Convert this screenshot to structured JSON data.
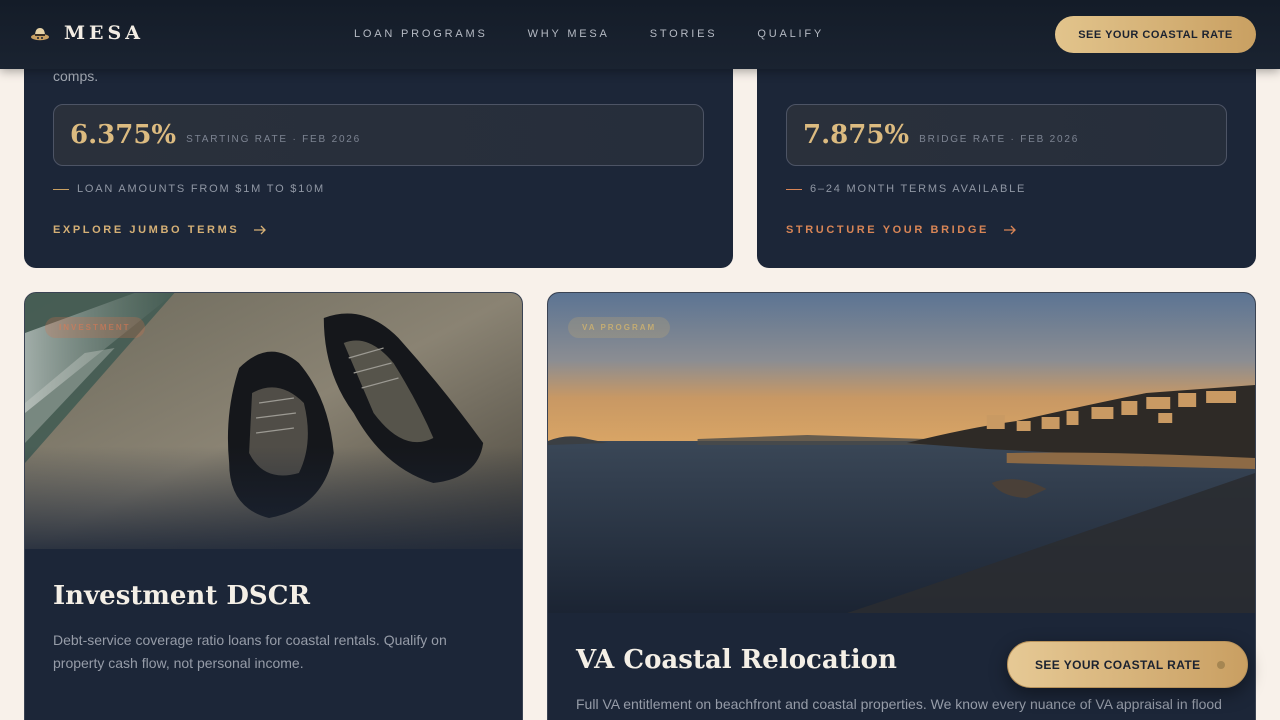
{
  "nav": {
    "brand": "MESA",
    "brand_icon": "hat-icon",
    "links": [
      "LOAN PROGRAMS",
      "WHY MESA",
      "STORIES",
      "QUALIFY"
    ],
    "cta_label": "SEE YOUR COASTAL RATE"
  },
  "cards": {
    "jumbo": {
      "desc_tail": "comps.",
      "rate": "6.375%",
      "rate_note": "STARTING RATE · FEB 2026",
      "feature": "LOAN AMOUNTS FROM $1M TO $10M",
      "link": "EXPLORE JUMBO TERMS"
    },
    "bridge": {
      "rate": "7.875%",
      "rate_note": "BRIDGE RATE · FEB 2026",
      "feature": "6–24 MONTH TERMS AVAILABLE",
      "link": "STRUCTURE YOUR BRIDGE"
    },
    "dscr": {
      "tag": "INVESTMENT",
      "title": "Investment DSCR",
      "text": "Debt-service coverage ratio loans for coastal rentals. Qualify on property cash flow, not personal income."
    },
    "va": {
      "tag": "VA PROGRAM",
      "title": "VA Coastal Relocation",
      "text": "Full VA entitlement on beachfront and coastal properties. We know every nuance of VA appraisal in flood"
    }
  },
  "floating_cta": {
    "label": "SEE YOUR COASTAL RATE"
  },
  "colors": {
    "navy": "#1c2638",
    "gold": "#dcbb80",
    "copper": "#d88556",
    "cream": "#f8f1ea"
  }
}
